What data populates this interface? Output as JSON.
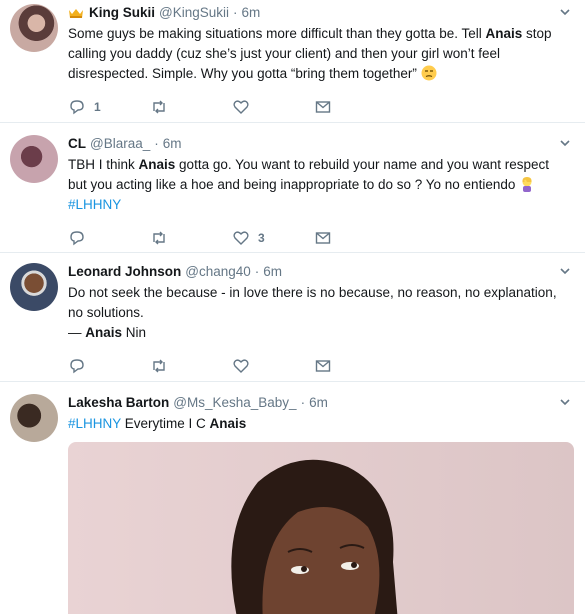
{
  "tweets": [
    {
      "name": "King Sukii",
      "handle": "@KingSukii",
      "time": "6m",
      "text_a": "Some guys be making situations more difficult than they gotta be. Tell ",
      "bold_a": "Anais",
      "text_b": " stop calling you daddy (cuz she’s just your client) and then your girl won’t feel disrespected. Simple. Why you gotta “bring them together”",
      "reply_count": "1",
      "like_count": ""
    },
    {
      "name": "CL",
      "handle": "@Blaraa_",
      "time": "6m",
      "text_a": "TBH I think ",
      "bold_a": "Anais",
      "text_b": " gotta go. You want to rebuild your name and you want respect but you acting like a hoe and being inappropriate to do so ? Yo no entiendo",
      "hashtag": "#LHHNY",
      "reply_count": "",
      "like_count": "3"
    },
    {
      "name": "Leonard Johnson",
      "handle": "@chang40",
      "time": "6m",
      "text_a": "Do not seek the because - in love there is no because, no reason, no explanation, no solutions.",
      "quote_prefix": "— ",
      "bold_a": "Anais",
      "quote_suffix": " Nin",
      "reply_count": "",
      "like_count": ""
    },
    {
      "name": "Lakesha Barton",
      "handle": "@Ms_Kesha_Baby_",
      "time": "6m",
      "hashtag": "#LHHNY",
      "text_a": " Everytime I C ",
      "bold_a": "Anais"
    }
  ],
  "separator": "·",
  "colors": {
    "accent": "#1b95e0",
    "muted": "#657786",
    "border": "#e6ecf0"
  },
  "icons": [
    "crown-icon",
    "reply-icon",
    "retweet-icon",
    "like-icon",
    "message-icon",
    "chevron-down-icon",
    "unamused-face-icon",
    "woman-facepalming-icon"
  ]
}
